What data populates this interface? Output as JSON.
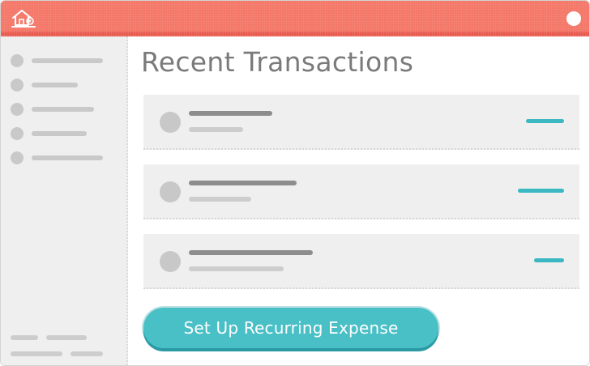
{
  "app": {
    "logo_icon": "house-icon",
    "colors": {
      "titlebar": "#f47768",
      "accent": "#49bfc6",
      "amount": "#3bb8c1"
    }
  },
  "main": {
    "title": "Recent Transactions",
    "transactions_count_shown": 3
  },
  "actions": {
    "recurring_button_label": "Set Up Recurring Expense"
  }
}
